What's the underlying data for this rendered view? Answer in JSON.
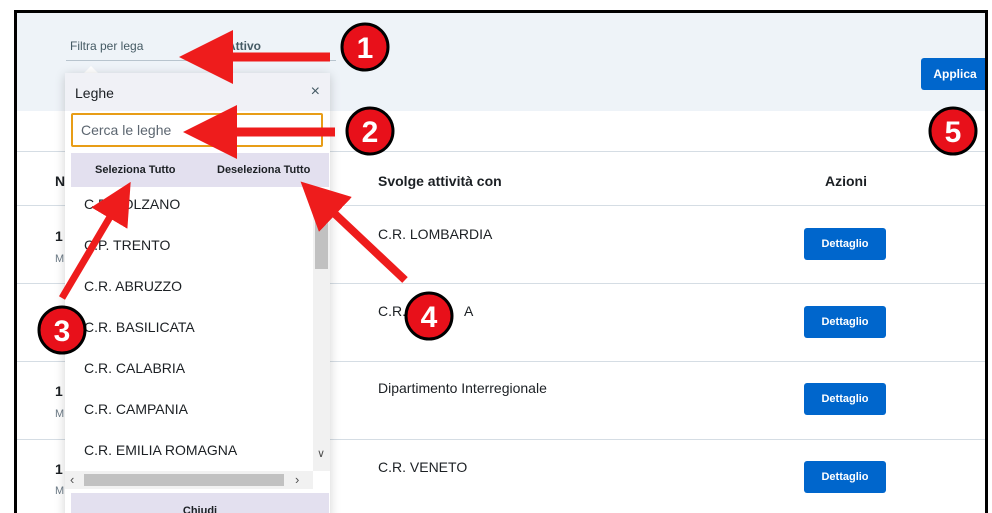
{
  "filter": {
    "label": "Filtra per lega",
    "status": "Attivo",
    "apply_label": "Applica"
  },
  "table": {
    "headers": {
      "first": "N",
      "activity": "Svolge attività con",
      "actions": "Azioni"
    },
    "rows": [
      {
        "num": "1",
        "sub": "M",
        "activity": "C.R. LOMBARDIA",
        "action_label": "Dettaglio"
      },
      {
        "num": "1",
        "sub": "",
        "activity": "C.R.",
        "activity_suffix": "A",
        "action_label": "Dettaglio"
      },
      {
        "num": "1",
        "sub": "M",
        "activity": "Dipartimento Interregionale",
        "action_label": "Dettaglio"
      },
      {
        "num": "1",
        "sub": "M",
        "activity": "C.R. VENETO",
        "action_label": "Dettaglio"
      }
    ]
  },
  "dropdown": {
    "title": "Leghe",
    "close_glyph": "×",
    "search_placeholder": "Cerca le leghe",
    "select_all_label": "Seleziona Tutto",
    "deselect_all_label": "Deseleziona Tutto",
    "items": [
      "C.P. BOLZANO",
      "C.P. TRENTO",
      "C.R. ABRUZZO",
      "C.R. BASILICATA",
      "C.R. CALABRIA",
      "C.R. CAMPANIA",
      "C.R. EMILIA ROMAGNA"
    ],
    "close_label": "Chiudi"
  },
  "annotations": {
    "markers": [
      "1",
      "2",
      "3",
      "4",
      "5"
    ],
    "marker_color": "#e8101a",
    "arrow_color": "#ee1c1c"
  },
  "colors": {
    "primary_button": "#0066cc",
    "search_focus_border": "#e89d17",
    "filter_background": "#eef3f8"
  }
}
